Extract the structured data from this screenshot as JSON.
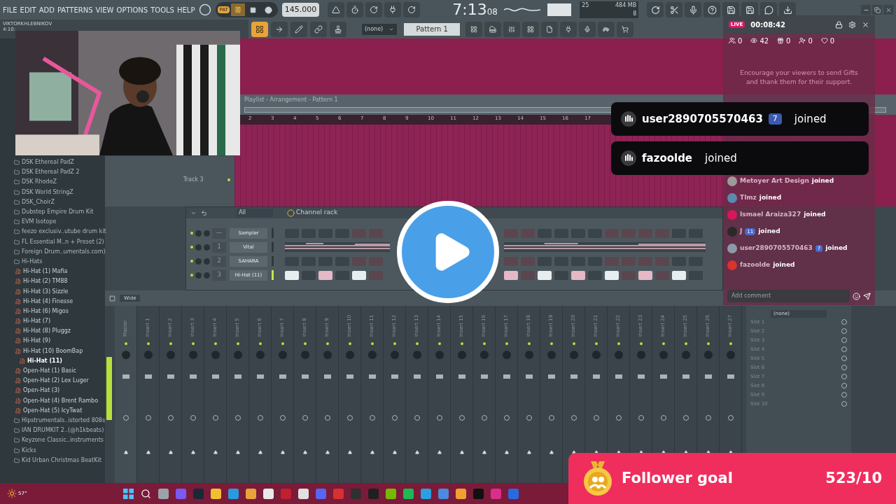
{
  "menu": [
    "FILE",
    "EDIT",
    "ADD",
    "PATTERNS",
    "VIEW",
    "OPTIONS",
    "TOOLS",
    "HELP"
  ],
  "transport": {
    "mode": "PAT",
    "playing": true,
    "tempo": "145.000"
  },
  "clock": {
    "time": "7:13",
    "seconds": "08"
  },
  "monitor": {
    "cpu": "25",
    "memory": "484 MB",
    "polyphony": "8"
  },
  "hint": {
    "title": "VIKTORKHLEBNIKOV",
    "value": "4:10:"
  },
  "toolbar": {
    "pattern_filter": "(none)",
    "pattern": "Pattern 1"
  },
  "browser": {
    "items": [
      {
        "kind": "folder",
        "label": "DSK Ethereal PadZ",
        "selected": false
      },
      {
        "kind": "folder",
        "label": "DSK Ethereal PadZ 2",
        "selected": false
      },
      {
        "kind": "folder",
        "label": "DSK RhodeZ",
        "selected": false
      },
      {
        "kind": "folder",
        "label": "DSK World StringZ",
        "selected": false
      },
      {
        "kind": "folder",
        "label": "DSK_ChoirZ",
        "selected": false
      },
      {
        "kind": "folder",
        "label": "Dubstep Empire Drum Kit",
        "selected": false
      },
      {
        "kind": "folder",
        "label": "EVM Isotope",
        "selected": false
      },
      {
        "kind": "folder",
        "label": "feezo exclusiv..utube drum kit",
        "selected": false
      },
      {
        "kind": "folder",
        "label": "FL Essential M..n + Preset (2)",
        "selected": false
      },
      {
        "kind": "folder",
        "label": "Foreign Drum..umentals.com)",
        "selected": false
      },
      {
        "kind": "folder",
        "label": "Hi-Hats",
        "selected": false,
        "children": [
          {
            "kind": "file",
            "label": "Hi-Hat (1) Mafia",
            "selected": false
          },
          {
            "kind": "file",
            "label": "Hi-Hat (2) TM88",
            "selected": false
          },
          {
            "kind": "file",
            "label": "Hi-Hat (3) Sizzle",
            "selected": false
          },
          {
            "kind": "file",
            "label": "Hi-Hat (4) Finesse",
            "selected": false
          },
          {
            "kind": "file",
            "label": "Hi-Hat (6) Migos",
            "selected": false
          },
          {
            "kind": "file",
            "label": "Hi-Hat (7)",
            "selected": false
          },
          {
            "kind": "file",
            "label": "Hi-Hat (8) Pluggz",
            "selected": false
          },
          {
            "kind": "file",
            "label": "Hi-Hat (9)",
            "selected": false
          },
          {
            "kind": "file",
            "label": "Hi-Hat (10) BoomBap",
            "selected": false
          },
          {
            "kind": "file",
            "label": "Hi-Hat (11)",
            "selected": true
          },
          {
            "kind": "file",
            "label": "Open-Hat (1) Basic",
            "selected": false
          },
          {
            "kind": "file",
            "label": "Open-Hat (2) Lex Luger",
            "selected": false
          },
          {
            "kind": "file",
            "label": "Open-Hat (3)",
            "selected": false
          },
          {
            "kind": "file",
            "label": "Open-Hat (4) Brent Rambo",
            "selected": false
          },
          {
            "kind": "file",
            "label": "Open-Hat (5) IcyTwat",
            "selected": false
          }
        ]
      },
      {
        "kind": "folder",
        "label": "Hipstrumentals..istorted 808s",
        "selected": false
      },
      {
        "kind": "folder",
        "label": "IAN DRUMKIT 2..(@h1kbeats)",
        "selected": false
      },
      {
        "kind": "folder",
        "label": "Keyzone Classic..instruments",
        "selected": false
      },
      {
        "kind": "folder",
        "label": "Kicks",
        "selected": false
      },
      {
        "kind": "folder",
        "label": "Kid Urban Christmas BeatKit",
        "selected": false
      }
    ]
  },
  "playlist": {
    "title": "Playlist - Arrangement - Pattern 1",
    "ruler": [
      "2",
      "3",
      "4",
      "5",
      "6",
      "7",
      "8",
      "9",
      "10",
      "11",
      "12",
      "13",
      "14",
      "15",
      "16",
      "17"
    ],
    "tracks": [
      {
        "name": "Track 3"
      }
    ]
  },
  "channel_rack": {
    "filter": "All",
    "title": "Channel rack",
    "channels": [
      {
        "number": "—",
        "name": "Sampler",
        "kind": "steps",
        "selected": false,
        "step_groups": [
          [
            false,
            false,
            false,
            false,
            false,
            false
          ],
          [
            false,
            false,
            false,
            false,
            false,
            false,
            false,
            false,
            false,
            false,
            false,
            false
          ]
        ]
      },
      {
        "number": "1",
        "name": "Vital",
        "kind": "piano",
        "selected": false
      },
      {
        "number": "2",
        "name": "SAHARA",
        "kind": "steps",
        "selected": false,
        "step_groups": [
          [
            false,
            false,
            false,
            false,
            false,
            false
          ],
          [
            false,
            false,
            false,
            false,
            false,
            false,
            false,
            false,
            false,
            false,
            false,
            false
          ]
        ]
      },
      {
        "number": "3",
        "name": "Hi-Hat (11)",
        "kind": "steps",
        "selected": true,
        "step_groups": [
          [
            true,
            false,
            true,
            false,
            true,
            false
          ],
          [
            true,
            false,
            true,
            false,
            true,
            false,
            true,
            false,
            true,
            false,
            true,
            false
          ]
        ]
      }
    ]
  },
  "mixer": {
    "mode": "Wide",
    "inserts": [
      "Master",
      "Insert 1",
      "Insert 2",
      "Insert 3",
      "Insert 4",
      "Insert 5",
      "Insert 6",
      "Insert 7",
      "Insert 8",
      "Insert 9",
      "Insert 10",
      "Insert 11",
      "Insert 12",
      "Insert 13",
      "Insert 14",
      "Insert 15",
      "Insert 16",
      "Insert 17",
      "Insert 18",
      "Insert 19",
      "Insert 20",
      "Insert 21",
      "Insert 22",
      "Insert 23",
      "Insert 24",
      "Insert 25",
      "Insert 26",
      "Insert 27"
    ],
    "preset": "(none)",
    "slots": [
      "Slot 1",
      "Slot 2",
      "Slot 3",
      "Slot 4",
      "Slot 5",
      "Slot 6",
      "Slot 7",
      "Slot 8",
      "Slot 9",
      "Slot 10"
    ]
  },
  "live": {
    "badge": "LIVE",
    "elapsed": "00:08:42",
    "stats": [
      {
        "kind": "members",
        "value": "0"
      },
      {
        "kind": "viewers",
        "value": "42"
      },
      {
        "kind": "gifts",
        "value": "0"
      },
      {
        "kind": "follows",
        "value": "0"
      },
      {
        "kind": "likes",
        "value": "0"
      }
    ],
    "hint": "Encourage your viewers to send Gifts and thank them for their support.",
    "comments": [
      {
        "user": "Metoyer Art Design",
        "action": "joined",
        "color": "#9a9a9a"
      },
      {
        "user": "Tlmz",
        "action": "joined",
        "color": "#5a8ab0"
      },
      {
        "user": "Ismael Araiza327",
        "action": "joined",
        "color": "#d8175a"
      },
      {
        "user": "J",
        "badge": "11",
        "action": "joined",
        "color": "#2a2a2a"
      },
      {
        "user": "user2890705570463",
        "badge": "7",
        "action": "joined",
        "color": "#8a9aa8"
      },
      {
        "user": "fazoolde",
        "action": "joined",
        "color": "#d8342a"
      }
    ],
    "comment_placeholder": "Add comment"
  },
  "toasts": [
    {
      "user": "user2890705570463",
      "badge": "7",
      "action": "joined"
    },
    {
      "user": "fazoolde",
      "action": "joined"
    }
  ],
  "follower_goal": {
    "title": "Follower goal",
    "progress": "523/10"
  },
  "taskbar": {
    "weather": "57°"
  }
}
